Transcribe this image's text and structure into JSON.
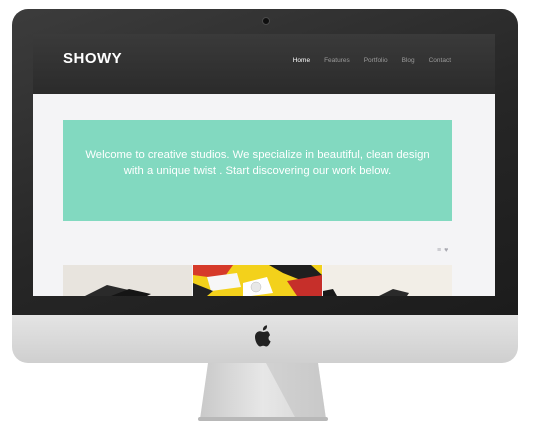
{
  "site": {
    "brand": "SHOWY",
    "nav": [
      {
        "label": "Home",
        "active": true
      },
      {
        "label": "Features",
        "active": false
      },
      {
        "label": "Portfolio",
        "active": false
      },
      {
        "label": "Blog",
        "active": false
      },
      {
        "label": "Contact",
        "active": false
      }
    ],
    "hero_text": "Welcome to creative studios. We specialize in beautiful, clean design with a unique twist . Start discovering our work below.",
    "filter_icons": [
      "grid-icon",
      "heart-icon"
    ],
    "gallery_tiles": [
      "portfolio-tile-1",
      "portfolio-tile-2",
      "portfolio-tile-3"
    ]
  },
  "device": {
    "logo": "apple-logo"
  },
  "colors": {
    "accent": "#82d9c0",
    "header_bg": "#333333",
    "page_bg": "#f4f4f6",
    "nav_inactive": "#9a9a9a",
    "nav_active": "#ffffff"
  }
}
